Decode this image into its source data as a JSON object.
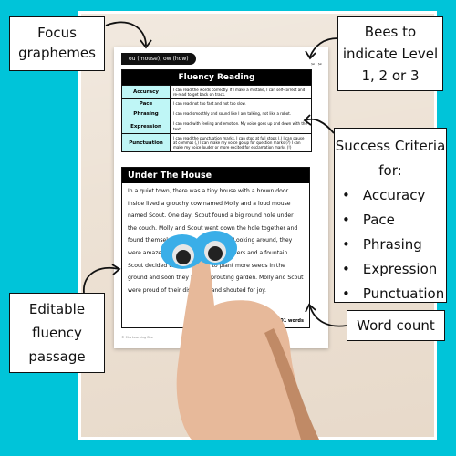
{
  "worksheet": {
    "focus_graphemes": "ou (mouse), ow (how)",
    "bees_label": "bees",
    "rubric": {
      "title": "Fluency Reading",
      "rows": [
        {
          "label": "Accuracy",
          "text": "I can read the words correctly. If I make a mistake, I can self-correct and re-read to get back on track."
        },
        {
          "label": "Pace",
          "text": "I can read not too fast and not too slow."
        },
        {
          "label": "Phrasing",
          "text": "I can read smoothly and sound like I am talking, not like a robot."
        },
        {
          "label": "Expression",
          "text": "I can read with feeling and emotion. My voice goes up and down with the text."
        },
        {
          "label": "Punctuation",
          "text": "I can read the punctuation marks. I can stop at full stops (.) I can pause at commas (,) I can make my voice go up for question marks (?) I can make my voice louder or more excited for exclamation marks (!)"
        }
      ]
    },
    "story": {
      "title": "Under The House",
      "text": "In a quiet town, there was a tiny house with a brown door. Inside lived a grouchy cow named Molly and a loud mouse named Scout. One day, Scout found a big round hole under the couch. Molly and Scout went down the hole together and found themselves in a secret garden. Looking around, they were amazed that it was full of sunflowers and a fountain. Scout decided to use a trowel to plant more seeds in the ground and soon they had a sprouting garden. Molly and Scout were proud of their discovery and shouted for joy.",
      "word_count": "101 words"
    },
    "copyright": "© Mrs Learning Bee"
  },
  "callouts": {
    "focus": "Focus graphemes",
    "bees": "Bees to indicate Level 1, 2 or 3",
    "success_title": "Success Criteria for:",
    "success_items": [
      "Accuracy",
      "Pace",
      "Phrasing",
      "Expression",
      "Punctuation"
    ],
    "word_count": "Word count",
    "editable": "Editable fluency passage"
  },
  "colors": {
    "background": "#00c4d9",
    "rubric_label_fill": "#bff6f6",
    "header_fill": "#000000"
  }
}
